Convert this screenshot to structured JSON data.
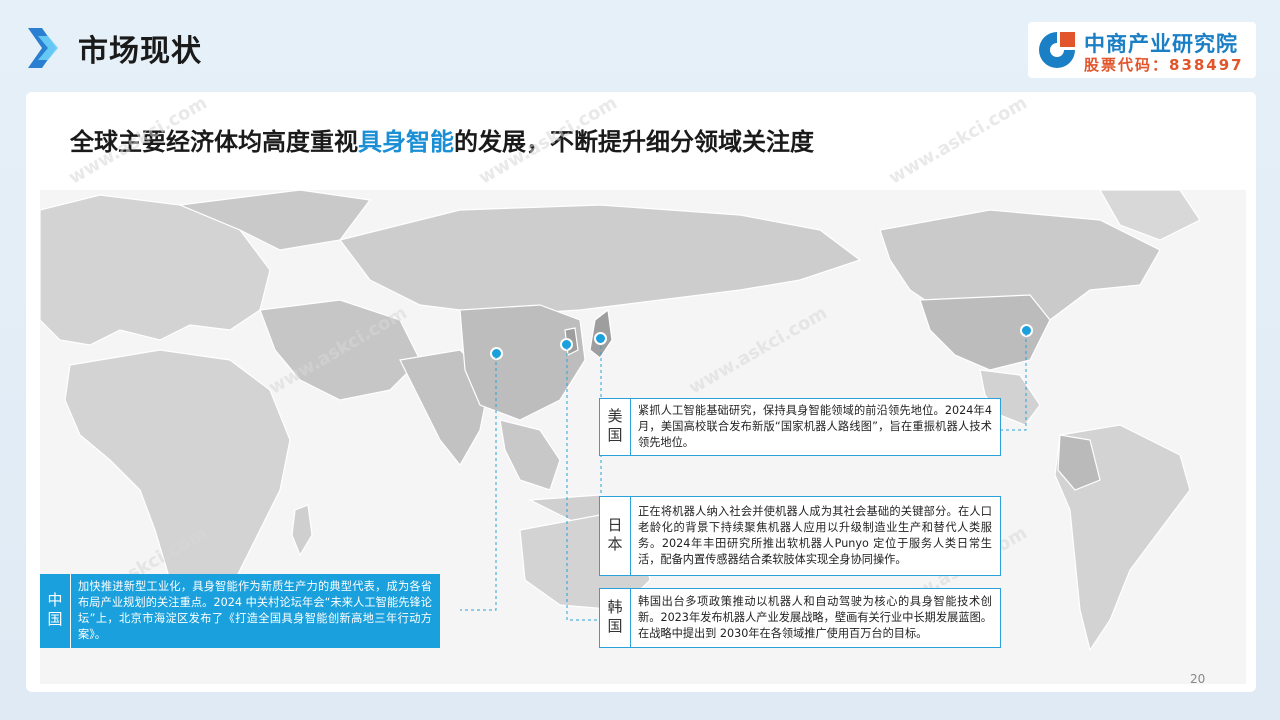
{
  "header": {
    "title": "市场现状"
  },
  "logo": {
    "name": "中商产业研究院",
    "stock": "股票代码：838497"
  },
  "subtitle": {
    "pre": "全球主要经济体均高度重视",
    "highlight": "具身智能",
    "post": "的发展，不断提升细分领域关注度"
  },
  "cards": {
    "usa": {
      "tag": "美国",
      "text": "紧抓人工智能基础研究，保持具身智能领域的前沿领先地位。2024年4月，美国高校联合发布新版“国家机器人路线图”，旨在重振机器人技术领先地位。"
    },
    "japan": {
      "tag": "日本",
      "text": "正在将机器人纳入社会并使机器人成为其社会基础的关键部分。在人口老龄化的背景下持续聚焦机器人应用以升级制造业生产和替代人类服务。2024年丰田研究所推出软机器人Punyo 定位于服务人类日常生活，配备内置传感器结合柔软肢体实现全身协同操作。"
    },
    "korea": {
      "tag": "韩国",
      "text": "韩国出台多项政策推动以机器人和自动驾驶为核心的具身智能技术创新。2023年发布机器人产业发展战略，壁画有关行业中长期发展蓝图。在战略中提出到 2030年在各领域推广使用百万台的目标。"
    },
    "china": {
      "tag": "中国",
      "text": "加快推进新型工业化，具身智能作为新质生产力的典型代表，成为各省布局产业规划的关注重点。2024 中关村论坛年会“未来人工智能先锋论坛”上，北京市海淀区发布了《打造全国具身智能创新高地三年行动方案》。"
    }
  },
  "page_number": "20",
  "colors": {
    "accent": "#1aa0dc",
    "brand_blue": "#1a7fc4",
    "brand_orange": "#e2552b",
    "map_land": "#d4d4d4"
  }
}
